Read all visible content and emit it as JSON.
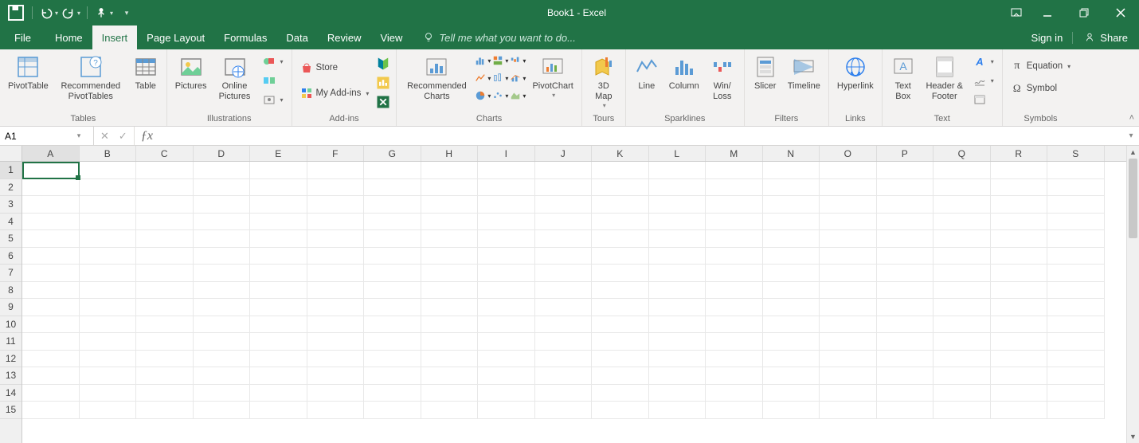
{
  "title": "Book1 - Excel",
  "qat": {
    "save": "save",
    "undo": "undo",
    "redo": "redo",
    "touch": "touch-mode",
    "customize": "customize"
  },
  "tabs": [
    "File",
    "Home",
    "Insert",
    "Page Layout",
    "Formulas",
    "Data",
    "Review",
    "View"
  ],
  "active_tab_index": 2,
  "tellme_placeholder": "Tell me what you want to do...",
  "signin": "Sign in",
  "share": "Share",
  "ribbon": {
    "groups": [
      {
        "name": "Tables",
        "items": [
          "PivotTable",
          "Recommended PivotTables",
          "Table"
        ]
      },
      {
        "name": "Illustrations",
        "items": [
          "Pictures",
          "Online Pictures"
        ],
        "small": [
          "Shapes",
          "SmartArt",
          "Screenshot"
        ]
      },
      {
        "name": "Add-ins",
        "items": [],
        "small": [
          "Store",
          "My Add-ins"
        ]
      },
      {
        "name": "Charts",
        "items": [
          "Recommended Charts",
          "PivotChart"
        ],
        "small_grid": true
      },
      {
        "name": "Tours",
        "items": [
          "3D Map"
        ]
      },
      {
        "name": "Sparklines",
        "items": [
          "Line",
          "Column",
          "Win/ Loss"
        ]
      },
      {
        "name": "Filters",
        "items": [
          "Slicer",
          "Timeline"
        ]
      },
      {
        "name": "Links",
        "items": [
          "Hyperlink"
        ]
      },
      {
        "name": "Text",
        "items": [
          "Text Box",
          "Header & Footer"
        ],
        "small": [
          "WordArt",
          "Signature",
          "Object"
        ]
      },
      {
        "name": "Symbols",
        "items": [],
        "small": [
          "Equation",
          "Symbol"
        ]
      }
    ]
  },
  "namebox": "A1",
  "formula": "",
  "columns": [
    "A",
    "B",
    "C",
    "D",
    "E",
    "F",
    "G",
    "H",
    "I",
    "J",
    "K",
    "L",
    "M",
    "N",
    "O",
    "P",
    "Q",
    "R",
    "S"
  ],
  "rows": [
    "1",
    "2",
    "3",
    "4",
    "5",
    "6",
    "7",
    "8",
    "9",
    "10",
    "11",
    "12",
    "13",
    "14",
    "15"
  ],
  "selected_cell": "A1",
  "icons": {
    "lightbulb": "lightbulb-icon",
    "pi": "π",
    "omega": "Ω"
  }
}
